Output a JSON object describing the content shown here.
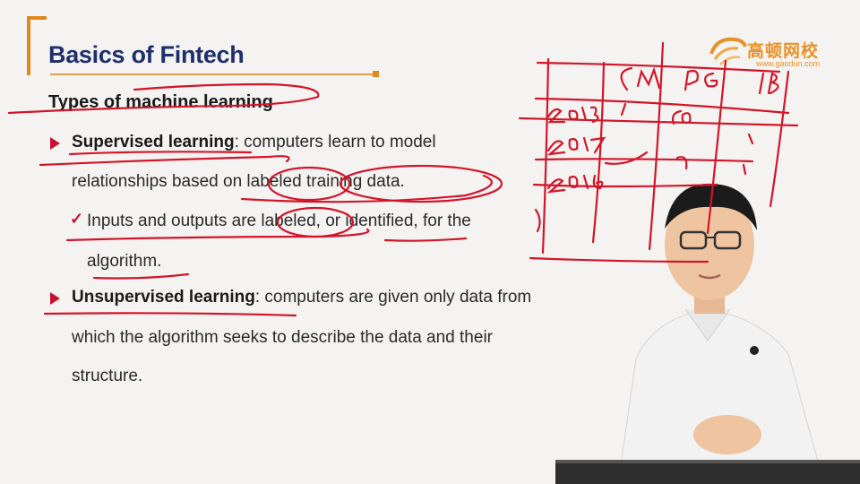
{
  "slide": {
    "title": "Basics of Fintech",
    "heading": "Types of machine learning",
    "bullets": [
      {
        "term": "Supervised learning",
        "text_line1": ": computers learn to model",
        "text_line2": "relationships based on labeled training data.",
        "sub": {
          "line1": "Inputs and outputs are labeled, or identified, for the",
          "line2": "algorithm."
        }
      },
      {
        "term": "Unsupervised learning",
        "text_line1": ": computers are given only data from",
        "text_line2": "which the algorithm seeks to describe the data and their",
        "text_line3": "structure."
      }
    ]
  },
  "logo": {
    "name": "高顿网校",
    "url": "www.gaodun.com"
  },
  "handwriting": {
    "columns": [
      "GM",
      "PG",
      "IB"
    ],
    "rows": [
      "2018",
      "2017",
      "2016"
    ],
    "cells": [
      "1",
      "50",
      "1",
      "",
      "",
      "1",
      "",
      "",
      "1"
    ]
  },
  "colors": {
    "ink": "#d3152a",
    "title": "#1e2f6b",
    "accent": "#e08a1e"
  }
}
